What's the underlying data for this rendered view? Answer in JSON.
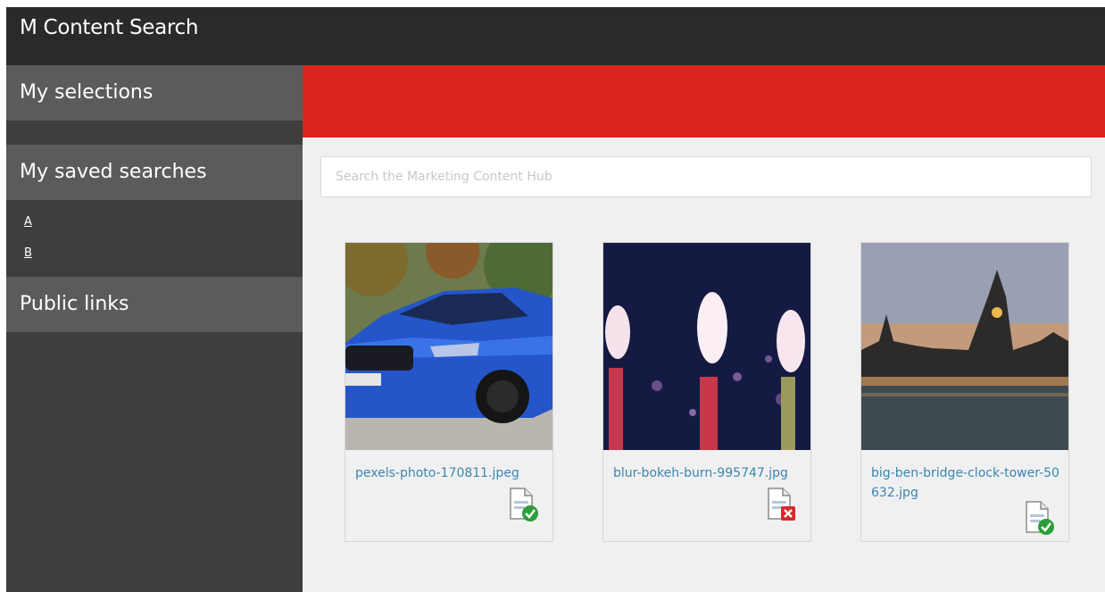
{
  "app": {
    "title": "M Content Search"
  },
  "sidebar": {
    "my_selections": "My selections",
    "saved_searches": {
      "label": "My saved searches",
      "items": [
        "A",
        "B"
      ]
    },
    "public_links": "Public links"
  },
  "colors": {
    "banner": "#da241d",
    "header": "#2a2a2a",
    "sidebar": "#3e3e3e",
    "link": "#3b86b0"
  },
  "search": {
    "placeholder": "Search the Marketing Content Hub",
    "value": ""
  },
  "assets": [
    {
      "filename": "pexels-photo-170811.jpeg",
      "status_icon": "document-check-icon"
    },
    {
      "filename": "blur-bokeh-burn-995747.jpg",
      "status_icon": "document-error-icon"
    },
    {
      "filename": "big-ben-bridge-clock-tower-50632.jpg",
      "status_icon": "document-check-icon"
    }
  ]
}
